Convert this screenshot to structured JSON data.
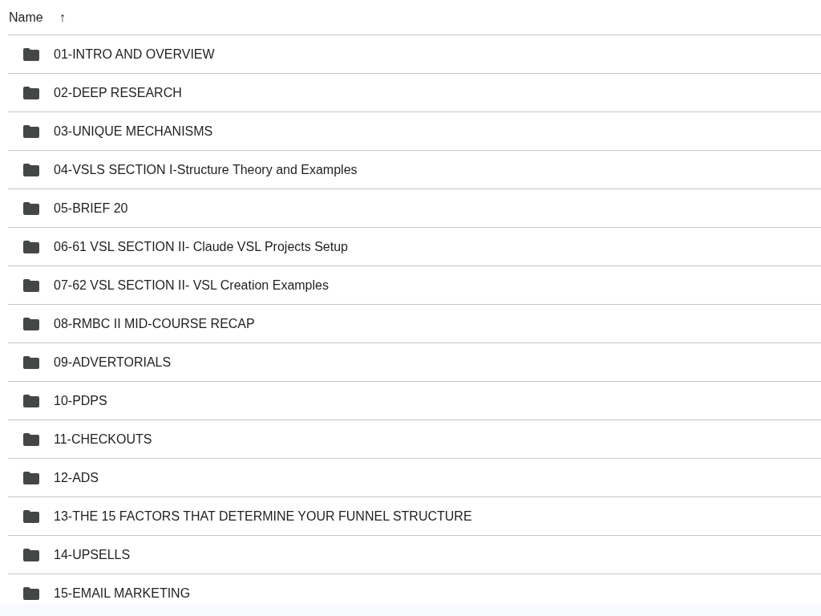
{
  "header": {
    "column": "Name",
    "sort_arrow": "↑"
  },
  "rows": [
    {
      "name": "01-INTRO AND OVERVIEW",
      "kind": "folder"
    },
    {
      "name": "02-DEEP RESEARCH",
      "kind": "folder"
    },
    {
      "name": "03-UNIQUE MECHANISMS",
      "kind": "folder"
    },
    {
      "name": "04-VSLS SECTION I-Structure Theory and Examples",
      "kind": "folder"
    },
    {
      "name": "05-BRIEF 20",
      "kind": "folder"
    },
    {
      "name": "06-61 VSL SECTION II- Claude VSL Projects Setup",
      "kind": "folder"
    },
    {
      "name": "07-62 VSL SECTION II- VSL Creation Examples",
      "kind": "folder"
    },
    {
      "name": "08-RMBC II MID-COURSE RECAP",
      "kind": "folder"
    },
    {
      "name": "09-ADVERTORIALS",
      "kind": "folder"
    },
    {
      "name": "10-PDPS",
      "kind": "folder"
    },
    {
      "name": "11-CHECKOUTS",
      "kind": "folder"
    },
    {
      "name": "12-ADS",
      "kind": "folder"
    },
    {
      "name": "13-THE 15 FACTORS THAT DETERMINE YOUR FUNNEL STRUCTURE",
      "kind": "folder"
    },
    {
      "name": "14-UPSELLS",
      "kind": "folder"
    },
    {
      "name": "15-EMAIL MARKETING",
      "kind": "folder"
    }
  ]
}
